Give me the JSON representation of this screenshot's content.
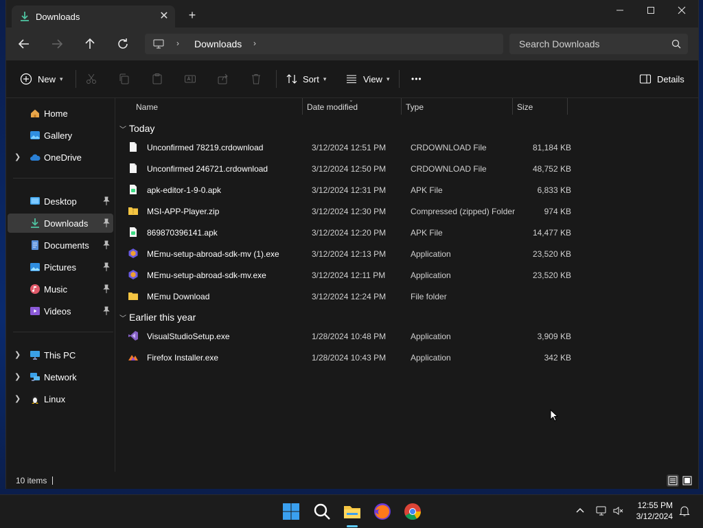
{
  "window": {
    "tab_title": "Downloads",
    "new_tab_symbol": "+",
    "close_tab_symbol": "✕"
  },
  "address": {
    "crumb": "Downloads",
    "search_placeholder": "Search Downloads"
  },
  "toolbar": {
    "new_label": "New",
    "sort_label": "Sort",
    "view_label": "View",
    "more_label": "•••",
    "details_label": "Details"
  },
  "sidebar": {
    "items": [
      {
        "label": "Home",
        "icon": "home-icon"
      },
      {
        "label": "Gallery",
        "icon": "gallery-icon"
      },
      {
        "label": "OneDrive",
        "icon": "cloud-icon"
      },
      {
        "label": "Desktop",
        "icon": "desktop-icon"
      },
      {
        "label": "Downloads",
        "icon": "download-icon"
      },
      {
        "label": "Documents",
        "icon": "documents-icon"
      },
      {
        "label": "Pictures",
        "icon": "pictures-icon"
      },
      {
        "label": "Music",
        "icon": "music-icon"
      },
      {
        "label": "Videos",
        "icon": "videos-icon"
      },
      {
        "label": "This PC",
        "icon": "pc-icon"
      },
      {
        "label": "Network",
        "icon": "network-icon"
      },
      {
        "label": "Linux",
        "icon": "linux-icon"
      }
    ]
  },
  "columns": {
    "name": "Name",
    "date": "Date modified",
    "type": "Type",
    "size": "Size"
  },
  "groups": [
    {
      "label": "Today",
      "files": [
        {
          "name": "Unconfirmed 78219.crdownload",
          "date": "3/12/2024 12:51 PM",
          "type": "CRDOWNLOAD File",
          "size": "81,184 KB",
          "icon": "file-icon"
        },
        {
          "name": "Unconfirmed 246721.crdownload",
          "date": "3/12/2024 12:50 PM",
          "type": "CRDOWNLOAD File",
          "size": "48,752 KB",
          "icon": "file-icon"
        },
        {
          "name": "apk-editor-1-9-0.apk",
          "date": "3/12/2024 12:31 PM",
          "type": "APK File",
          "size": "6,833 KB",
          "icon": "apk-icon"
        },
        {
          "name": "MSI-APP-Player.zip",
          "date": "3/12/2024 12:30 PM",
          "type": "Compressed (zipped) Folder",
          "size": "974 KB",
          "icon": "zip-icon"
        },
        {
          "name": "869870396141.apk",
          "date": "3/12/2024 12:20 PM",
          "type": "APK File",
          "size": "14,477 KB",
          "icon": "apk-icon"
        },
        {
          "name": "MEmu-setup-abroad-sdk-mv (1).exe",
          "date": "3/12/2024 12:13 PM",
          "type": "Application",
          "size": "23,520 KB",
          "icon": "memu-icon"
        },
        {
          "name": "MEmu-setup-abroad-sdk-mv.exe",
          "date": "3/12/2024 12:11 PM",
          "type": "Application",
          "size": "23,520 KB",
          "icon": "memu-icon"
        },
        {
          "name": "MEmu Download",
          "date": "3/12/2024 12:24 PM",
          "type": "File folder",
          "size": "",
          "icon": "folder-icon"
        }
      ]
    },
    {
      "label": "Earlier this year",
      "files": [
        {
          "name": "VisualStudioSetup.exe",
          "date": "1/28/2024 10:48 PM",
          "type": "Application",
          "size": "3,909 KB",
          "icon": "visual-studio-icon"
        },
        {
          "name": "Firefox Installer.exe",
          "date": "1/28/2024 10:43 PM",
          "type": "Application",
          "size": "342 KB",
          "icon": "firefox-installer-icon"
        }
      ]
    }
  ],
  "status": {
    "item_count": "10 items"
  },
  "taskbar": {
    "time": "12:55 PM",
    "date": "3/12/2024"
  },
  "colors": {
    "accent": "#60cdff",
    "folder": "#f5c542",
    "download_green": "#4fc3a1"
  }
}
